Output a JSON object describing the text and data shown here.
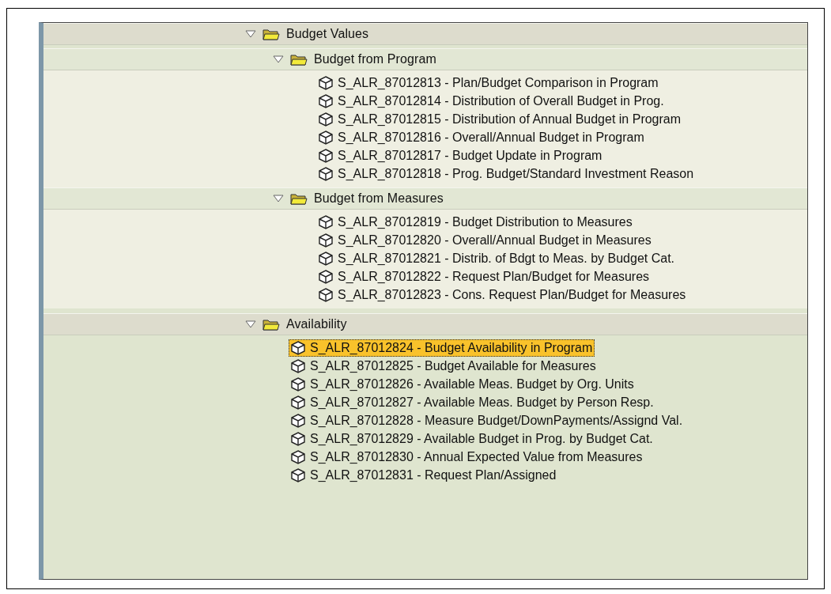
{
  "tree": [
    {
      "label": "Budget Values",
      "expanded": true,
      "children": [
        {
          "label": "Budget from Program",
          "expanded": true,
          "children": [
            {
              "label": "S_ALR_87012813 - Plan/Budget Comparison in Program",
              "selected": false
            },
            {
              "label": "S_ALR_87012814 - Distribution of Overall Budget in Prog.",
              "selected": false
            },
            {
              "label": "S_ALR_87012815 - Distribution of Annual Budget in Program",
              "selected": false
            },
            {
              "label": "S_ALR_87012816 - Overall/Annual Budget in Program",
              "selected": false
            },
            {
              "label": "S_ALR_87012817 - Budget Update in Program",
              "selected": false
            },
            {
              "label": "S_ALR_87012818 - Prog. Budget/Standard Investment Reason",
              "selected": false
            }
          ]
        },
        {
          "label": "Budget from Measures",
          "expanded": true,
          "children": [
            {
              "label": "S_ALR_87012819 - Budget Distribution to Measures",
              "selected": false
            },
            {
              "label": "S_ALR_87012820 - Overall/Annual Budget in Measures",
              "selected": false
            },
            {
              "label": "S_ALR_87012821 - Distrib. of Bdgt to Meas. by Budget Cat.",
              "selected": false
            },
            {
              "label": "S_ALR_87012822 - Request Plan/Budget for Measures",
              "selected": false
            },
            {
              "label": "S_ALR_87012823 - Cons. Request Plan/Budget for Measures",
              "selected": false
            }
          ]
        }
      ]
    },
    {
      "label": "Availability",
      "expanded": true,
      "children": [
        {
          "label": "S_ALR_87012824 - Budget Availability in Program",
          "selected": true
        },
        {
          "label": "S_ALR_87012825 - Budget Available for Measures",
          "selected": false
        },
        {
          "label": "S_ALR_87012826 - Available Meas. Budget by Org. Units",
          "selected": false
        },
        {
          "label": "S_ALR_87012827 - Available Meas. Budget by Person Resp.",
          "selected": false
        },
        {
          "label": "S_ALR_87012828 - Measure Budget/DownPayments/Assignd Val.",
          "selected": false
        },
        {
          "label": "S_ALR_87012829 - Available Budget in Prog. by Budget Cat.",
          "selected": false
        },
        {
          "label": "S_ALR_87012830 - Annual Expected Value from Measures",
          "selected": false
        },
        {
          "label": "S_ALR_87012831 - Request Plan/Assigned",
          "selected": false
        }
      ]
    }
  ]
}
